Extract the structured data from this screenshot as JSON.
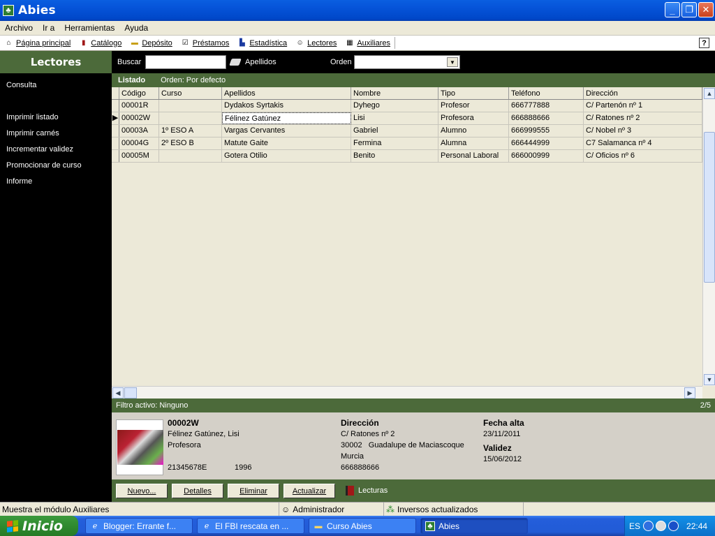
{
  "window": {
    "title": "Abies"
  },
  "menu": [
    "Archivo",
    "Ir a",
    "Herramientas",
    "Ayuda"
  ],
  "toolbar": {
    "items": [
      {
        "label": "Página principal",
        "icon": "home-icon"
      },
      {
        "label": "Catálogo",
        "icon": "books-icon"
      },
      {
        "label": "Depósito",
        "icon": "storage-icon"
      },
      {
        "label": "Préstamos",
        "icon": "loan-check-icon"
      },
      {
        "label": "Estadística",
        "icon": "bar-chart-icon"
      },
      {
        "label": "Lectores",
        "icon": "reader-icon"
      },
      {
        "label": "Auxiliares",
        "icon": "table-icon"
      }
    ],
    "help": "?"
  },
  "sidebar": {
    "title": "Lectores",
    "links": [
      "Consulta",
      "Imprimir listado",
      "Imprimir carnés",
      "Incrementar validez",
      "Promocionar de curso",
      "Informe"
    ]
  },
  "search": {
    "label": "Buscar",
    "value": "",
    "field": "Apellidos",
    "order_label": "Orden",
    "order_value": ""
  },
  "listado": {
    "title": "Listado",
    "order": "Orden: Por defecto"
  },
  "table": {
    "columns": [
      "Código",
      "Curso",
      "Apellidos",
      "Nombre",
      "Tipo",
      "Teléfono",
      "Dirección"
    ],
    "rows": [
      [
        "00001R",
        "",
        "Dydakos Syrtakis",
        "Dyhego",
        "Profesor",
        "666777888",
        "C/ Partenón nº 1"
      ],
      [
        "00002W",
        "",
        "Félinez Gatúnez",
        "Lisi",
        "Profesora",
        "666888666",
        "C/ Ratones nº 2"
      ],
      [
        "00003A",
        "1º ESO A",
        "Vargas Cervantes",
        "Gabriel",
        "Alumno",
        "666999555",
        "C/ Nobel nº 3"
      ],
      [
        "00004G",
        "2º ESO B",
        "Matute Gaite",
        "Fermina",
        "Alumna",
        "666444999",
        "C7 Salamanca nº 4"
      ],
      [
        "00005M",
        "",
        "Gotera Otilio",
        "Benito",
        "Personal Laboral",
        "666000999",
        "C/ Oficios nº 6"
      ]
    ],
    "selected_row": 1
  },
  "filter": {
    "label": "Filtro activo: Ninguno",
    "position": "2/5"
  },
  "detail": {
    "code": "00002W",
    "full_name": "Félinez Gatúnez, Lisi",
    "type": "Profesora",
    "id_number": "21345678E",
    "year": "1996",
    "address_title": "Dirección",
    "street": "C/ Ratones nº 2",
    "postal_city": "30002   Guadalupe de Maciascoque",
    "province": "Murcia",
    "phone": "666888666",
    "signup_title": "Fecha alta",
    "signup_date": "23/11/2011",
    "validity_title": "Validez",
    "validity_date": "15/06/2012"
  },
  "actions": {
    "nuevo": "Nuevo...",
    "detalles": "Detalles",
    "eliminar": "Eliminar",
    "actualizar": "Actualizar",
    "lecturas": "Lecturas"
  },
  "status": {
    "message": "Muestra el módulo Auxiliares",
    "user": "Administrador",
    "sync": "Inversos actualizados"
  },
  "taskbar": {
    "start": "Inicio",
    "tasks": [
      {
        "label": "Blogger: Errante f...",
        "icon": "ie-icon"
      },
      {
        "label": "El FBI rescata en ...",
        "icon": "ie-icon"
      },
      {
        "label": "Curso Abies",
        "icon": "folder-icon"
      },
      {
        "label": "Abies",
        "icon": "abies-icon"
      }
    ],
    "lang": "ES",
    "clock": "22:44"
  }
}
